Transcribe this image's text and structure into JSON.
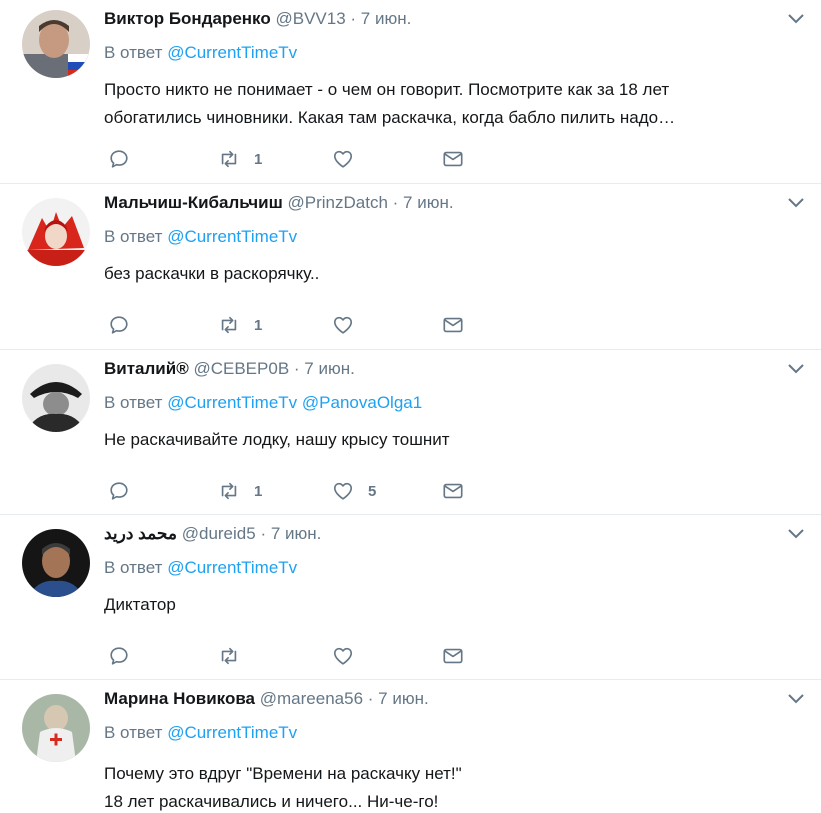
{
  "tweets": [
    {
      "name": "Виктор Бондаренко",
      "handle": "@BVV13",
      "dot": "·",
      "time": "7 июн.",
      "reply_prefix": "В ответ",
      "mentions": [
        "@CurrentTimeTv"
      ],
      "text_lines": [
        "Просто никто не понимает - о чем он говорит. Посмотрите как за 18 лет",
        "обогатились чиновники. Какая там раскачка, когда бабло пилить надо…"
      ],
      "retweets": "1",
      "likes": ""
    },
    {
      "name": "Мальчиш-Кибальчиш",
      "handle": "@PrinzDatch",
      "dot": "·",
      "time": "7 июн.",
      "reply_prefix": "В ответ",
      "mentions": [
        "@CurrentTimeTv"
      ],
      "text_lines": [
        "без раскачки в раскорячку.."
      ],
      "retweets": "1",
      "likes": ""
    },
    {
      "name": "Виталий®",
      "handle": "@СЕВЕР0В",
      "dot": "·",
      "time": "7 июн.",
      "reply_prefix": "В ответ",
      "mentions": [
        "@CurrentTimeTv",
        "@PanovaOlga1"
      ],
      "text_lines": [
        "Не раскачивайте лодку, нашу крысу тошнит"
      ],
      "retweets": "1",
      "likes": "5"
    },
    {
      "name": "محمد درید",
      "handle": "@dureid5",
      "dot": "·",
      "time": "7 июн.",
      "reply_prefix": "В ответ",
      "mentions": [
        "@CurrentTimeTv"
      ],
      "text_lines": [
        "Диктатор"
      ],
      "retweets": "",
      "likes": ""
    },
    {
      "name": "Марина Новикова",
      "handle": "@mareena56",
      "dot": "·",
      "time": "7 июн.",
      "reply_prefix": "В ответ",
      "mentions": [
        "@CurrentTimeTv"
      ],
      "text_lines": [
        "Почему это вдруг \"Времени на раскачку нет!\"",
        "18 лет раскачивались и ничего... Ни-че-го!"
      ],
      "retweets": "",
      "likes": ""
    }
  ],
  "colors": {
    "link": "#1da1f2",
    "muted": "#657786",
    "text": "#14171a",
    "divider": "#e6ecf0"
  },
  "icons": [
    "chevron-down-icon",
    "reply-icon",
    "retweet-icon",
    "like-icon",
    "direct-message-icon"
  ]
}
